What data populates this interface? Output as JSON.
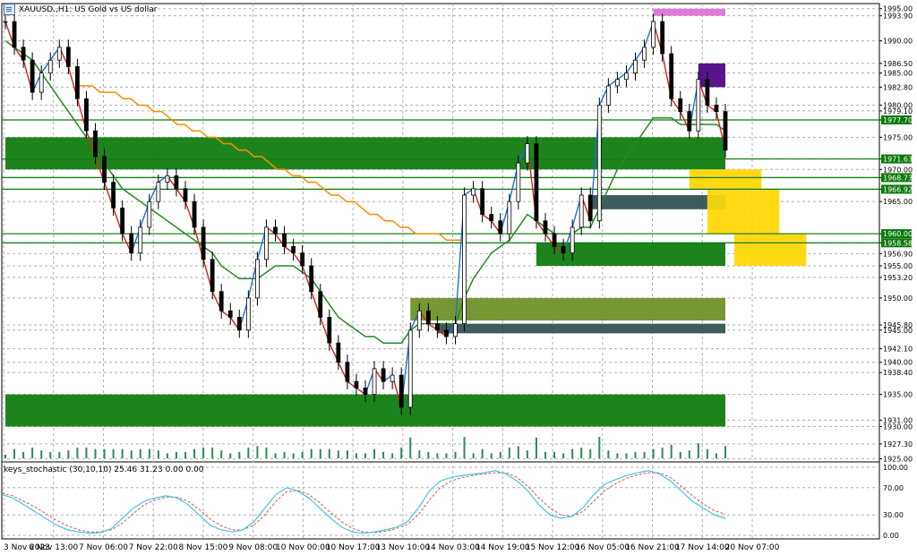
{
  "header": {
    "symbol_text": "XAUUSD.,H1: US Gold vs US dollar",
    "indicator_text": "keys_stochastic (30,10,10) 25.46 31.23 0.00 0.00"
  },
  "colors": {
    "bull": "#1e6fd9",
    "bear": "#d92020",
    "zone_green": "#0a7a0a",
    "zone_olive": "#6b8e23",
    "zone_slate": "#2f4f4f",
    "zone_gold": "#ffd700",
    "zone_magenta": "#da70d6",
    "zone_indigo": "#4b0082",
    "ma_fast": "#228b22",
    "ma_orange": "#ff8c00",
    "stoch_main": "#40c8e0",
    "stoch_signal": "#e05050"
  },
  "chart_data": [
    {
      "type": "line",
      "title": "XAUUSD.,H1: US Gold vs US dollar",
      "x_labels": [
        "3 Nov 2023",
        "6 Nov 13:00",
        "7 Nov 06:00",
        "7 Nov 22:00",
        "8 Nov 15:00",
        "9 Nov 08:00",
        "10 Nov 00:00",
        "10 Nov 17:00",
        "13 Nov 10:00",
        "14 Nov 03:00",
        "14 Nov 19:00",
        "15 Nov 12:00",
        "16 Nov 05:00",
        "16 Nov 21:00",
        "17 Nov 14:00",
        "20 Nov 07:00"
      ],
      "y_ticks": [
        1925.0,
        1927.3,
        1930.0,
        1931.0,
        1935.0,
        1938.4,
        1940.0,
        1942.1,
        1945.0,
        1945.8,
        1950.0,
        1953.2,
        1955.0,
        1956.9,
        1958.58,
        1960.0,
        1965.0,
        1966.92,
        1968.73,
        1970.0,
        1971.63,
        1975.0,
        1977.7,
        1979.1,
        1980.0,
        1982.8,
        1985.0,
        1986.5,
        1990.0,
        1993.9,
        1995.0
      ],
      "ylim": [
        1924.5,
        1995.8
      ],
      "grid": true,
      "series": [
        {
          "values": [
            1993,
            1989,
            1987,
            1982,
            1985,
            1987,
            1989,
            1986,
            1981,
            1976,
            1972,
            1968,
            1964,
            1960,
            1957,
            1961,
            1965,
            1968,
            1969,
            1967,
            1965,
            1961,
            1956,
            1951,
            1948,
            1947,
            1945,
            1950,
            1956,
            1961,
            1960,
            1958,
            1957,
            1955,
            1951,
            1947,
            1943,
            1940,
            1937,
            1936,
            1935,
            1939,
            1937,
            1938,
            1933,
            1945,
            1948,
            1946,
            1945,
            1944,
            1946,
            1966,
            1967,
            1963,
            1962,
            1960,
            1965,
            1971,
            1974,
            1962,
            1960,
            1958,
            1957,
            1961,
            1966,
            1962,
            1980,
            1983,
            1984,
            1985,
            1987,
            1989,
            1993,
            1988,
            1981,
            1979,
            1976,
            1984,
            1980,
            1979,
            1973
          ]
        },
        {
          "values": [
            1990,
            1989,
            1988,
            1987,
            1985,
            1983,
            1981,
            1979,
            1977,
            1975,
            1973,
            1971,
            1969,
            1967,
            1966,
            1965,
            1964,
            1963,
            1962,
            1961,
            1960,
            1959,
            1958,
            1957,
            1955,
            1954,
            1953,
            1953,
            1953,
            1954,
            1955,
            1955,
            1955,
            1954,
            1953,
            1951,
            1949,
            1947,
            1946,
            1945,
            1944,
            1944,
            1943,
            1943,
            1943,
            1945,
            1946,
            1946,
            1946,
            1946,
            1946,
            1950,
            1953,
            1955,
            1957,
            1958,
            1959,
            1961,
            1963,
            1962,
            1961,
            1960,
            1960,
            1960,
            1961,
            1961,
            1964,
            1967,
            1970,
            1972,
            1974,
            1976,
            1978,
            1978,
            1978,
            1977,
            1977,
            1977,
            1977,
            1977,
            1976
          ]
        },
        {
          "values": [
            1983,
            1983,
            1983,
            1982,
            1982,
            1982,
            1981,
            1981,
            1980,
            1980,
            1979,
            1979,
            1978,
            1977,
            1977,
            1976,
            1976,
            1975,
            1975,
            1974,
            1974,
            1973,
            1973,
            1972,
            1972,
            1971,
            1970,
            1970,
            1969,
            1969,
            1968,
            1968,
            1967,
            1966,
            1966,
            1965,
            1965,
            1964,
            1963,
            1963,
            1962,
            1962,
            1961,
            1961,
            1960,
            1960,
            1960,
            1960,
            1959,
            1959,
            1959
          ]
        }
      ],
      "zones": [
        {
          "low": 1971.63,
          "high": 1975.0,
          "color": "green",
          "from": 0,
          "to": 80
        },
        {
          "low": 1970.0,
          "high": 1971.63,
          "color": "green",
          "from": 0,
          "to": 80
        },
        {
          "low": 1930.0,
          "high": 1935.0,
          "color": "green",
          "from": 0,
          "to": 80
        },
        {
          "low": 1955.0,
          "high": 1958.58,
          "color": "green",
          "from": 59,
          "to": 80
        },
        {
          "low": 1946.5,
          "high": 1950.0,
          "color": "olive",
          "from": 45,
          "to": 80
        },
        {
          "low": 1944.5,
          "high": 1946.0,
          "color": "slate",
          "from": 48,
          "to": 80
        },
        {
          "low": 1963.8,
          "high": 1966.0,
          "color": "slate",
          "from": 65,
          "to": 78
        },
        {
          "low": 1963.8,
          "high": 1966.0,
          "color": "blue",
          "from": 78,
          "to": 80
        },
        {
          "low": 1993.9,
          "high": 1995.0,
          "color": "magenta",
          "from": 72,
          "to": 80
        },
        {
          "low": 1982.8,
          "high": 1986.5,
          "color": "indigo",
          "from": 77,
          "to": 80
        },
        {
          "low": 1966.92,
          "high": 1970.0,
          "color": "gold",
          "from": 76,
          "to": 84
        },
        {
          "low": 1960.0,
          "high": 1966.92,
          "color": "gold",
          "from": 78,
          "to": 86
        },
        {
          "low": 1955.0,
          "high": 1960.0,
          "color": "gold",
          "from": 81,
          "to": 89
        }
      ],
      "levels": [
        1977.7,
        1971.63,
        1968.73,
        1966.92,
        1960.0,
        1958.58
      ]
    },
    {
      "type": "line",
      "title": "keys_stochastic (30,10,10) 25.46 31.23 0.00 0.00",
      "x_labels": [
        "3 Nov 2023",
        "6 Nov 13:00",
        "7 Nov 06:00",
        "7 Nov 22:00",
        "8 Nov 15:00",
        "9 Nov 08:00",
        "10 Nov 00:00",
        "10 Nov 17:00",
        "13 Nov 10:00",
        "14 Nov 03:00",
        "14 Nov 19:00",
        "15 Nov 12:00",
        "16 Nov 05:00",
        "16 Nov 21:00",
        "17 Nov 14:00",
        "20 Nov 07:00"
      ],
      "y_ticks": [
        100.0,
        70.0,
        30.0,
        0.0
      ],
      "ylim": [
        0,
        100
      ],
      "grid": true,
      "series": [
        {
          "values": [
            60,
            55,
            45,
            35,
            25,
            15,
            8,
            5,
            3,
            4,
            10,
            25,
            40,
            50,
            55,
            58,
            55,
            45,
            30,
            15,
            8,
            5,
            8,
            20,
            40,
            60,
            70,
            65,
            55,
            40,
            25,
            12,
            5,
            3,
            5,
            8,
            12,
            20,
            40,
            65,
            80,
            85,
            88,
            90,
            92,
            95,
            90,
            80,
            65,
            45,
            30,
            25,
            28,
            40,
            60,
            75,
            82,
            88,
            92,
            95,
            90,
            80,
            65,
            50,
            40,
            30,
            25
          ]
        },
        {
          "values": [
            62,
            58,
            50,
            42,
            32,
            22,
            14,
            8,
            5,
            5,
            8,
            18,
            32,
            45,
            52,
            56,
            56,
            50,
            38,
            24,
            14,
            8,
            8,
            15,
            30,
            50,
            64,
            66,
            60,
            48,
            33,
            20,
            10,
            5,
            4,
            6,
            10,
            16,
            30,
            52,
            70,
            80,
            85,
            88,
            90,
            92,
            92,
            85,
            72,
            55,
            40,
            30,
            28,
            35,
            50,
            66,
            76,
            84,
            89,
            92,
            92,
            85,
            72,
            58,
            46,
            36,
            31
          ]
        }
      ]
    }
  ]
}
